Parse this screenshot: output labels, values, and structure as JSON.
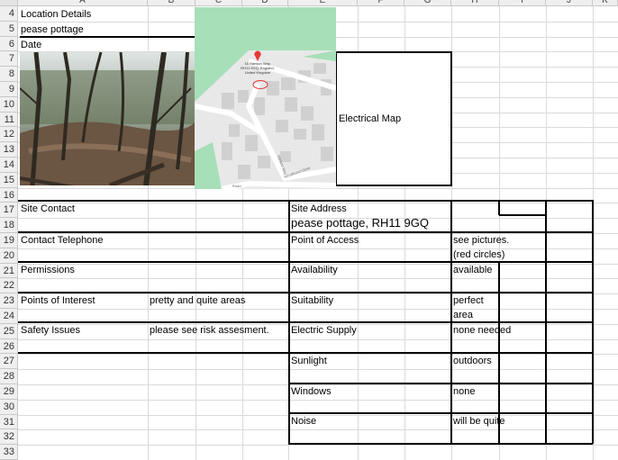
{
  "columns": [
    "A",
    "B",
    "C",
    "D",
    "E",
    "F",
    "G",
    "H",
    "I",
    "J",
    "K"
  ],
  "rows": [
    "4",
    "5",
    "6",
    "7",
    "8",
    "9",
    "10",
    "11",
    "12",
    "13",
    "14",
    "15",
    "16",
    "17",
    "18",
    "19",
    "20",
    "21",
    "22",
    "23",
    "24",
    "25",
    "26",
    "27",
    "28",
    "29",
    "30",
    "31",
    "32",
    "33"
  ],
  "cells": {
    "a4": "Location Details",
    "a5": "pease pottage",
    "a6": "Date",
    "electrical_map": "Electrical Map",
    "site_contact": "Site Contact",
    "site_address": "Site Address",
    "site_address_value": "pease pottage, RH11 9GQ",
    "contact_telephone": "Contact Telephone",
    "point_of_access": "Point of Access",
    "point_of_access_value1": "see pictures.",
    "point_of_access_value2": "(red circles)",
    "permissions": "Permissions",
    "availability": "Availability",
    "availability_value": "available",
    "points_of_interest": "Points of Interest",
    "points_of_interest_value": "pretty and quite areas",
    "suitability": "Suitability",
    "suitability_value1": "perfect",
    "suitability_value2": "area",
    "safety_issues": "Safety Issues",
    "safety_issues_value": "please see risk assesment.",
    "electric_supply": "Electric Supply",
    "electric_supply_value": "none needed",
    "sunlight": "Sunlight",
    "sunlight_value": "outdoors",
    "windows": "Windows",
    "windows_value": "none",
    "noise": "Noise",
    "noise_value": "will be quite"
  },
  "map": {
    "pin_label_lines": [
      "15 Hanson Way,",
      "RH11 9GQ, England,",
      "United Kingdom"
    ],
    "road_label_1": "Hanson Way",
    "road_label_2": "Woodhurst Close",
    "road_label_3": "Road"
  },
  "colors": {
    "map_green": "#a7dfb8",
    "map_bg": "#e8e8e8",
    "pin": "#e53935"
  }
}
